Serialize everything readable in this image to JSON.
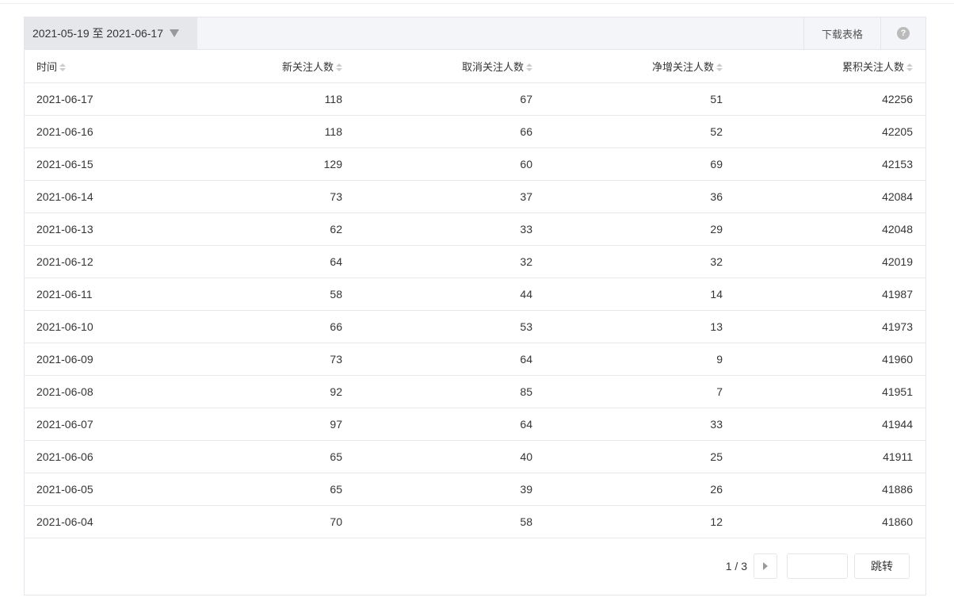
{
  "toolbar": {
    "date_range": "2021-05-19 至 2021-06-17",
    "download_label": "下载表格",
    "help_icon": "?"
  },
  "table": {
    "columns": [
      "时间",
      "新关注人数",
      "取消关注人数",
      "净增关注人数",
      "累积关注人数"
    ],
    "rows": [
      [
        "2021-06-17",
        "118",
        "67",
        "51",
        "42256"
      ],
      [
        "2021-06-16",
        "118",
        "66",
        "52",
        "42205"
      ],
      [
        "2021-06-15",
        "129",
        "60",
        "69",
        "42153"
      ],
      [
        "2021-06-14",
        "73",
        "37",
        "36",
        "42084"
      ],
      [
        "2021-06-13",
        "62",
        "33",
        "29",
        "42048"
      ],
      [
        "2021-06-12",
        "64",
        "32",
        "32",
        "42019"
      ],
      [
        "2021-06-11",
        "58",
        "44",
        "14",
        "41987"
      ],
      [
        "2021-06-10",
        "66",
        "53",
        "13",
        "41973"
      ],
      [
        "2021-06-09",
        "73",
        "64",
        "9",
        "41960"
      ],
      [
        "2021-06-08",
        "92",
        "85",
        "7",
        "41951"
      ],
      [
        "2021-06-07",
        "97",
        "64",
        "33",
        "41944"
      ],
      [
        "2021-06-06",
        "65",
        "40",
        "25",
        "41911"
      ],
      [
        "2021-06-05",
        "65",
        "39",
        "26",
        "41886"
      ],
      [
        "2021-06-04",
        "70",
        "58",
        "12",
        "41860"
      ]
    ]
  },
  "pagination": {
    "page_info": "1 / 3",
    "jump_input_value": "",
    "jump_label": "跳转"
  }
}
